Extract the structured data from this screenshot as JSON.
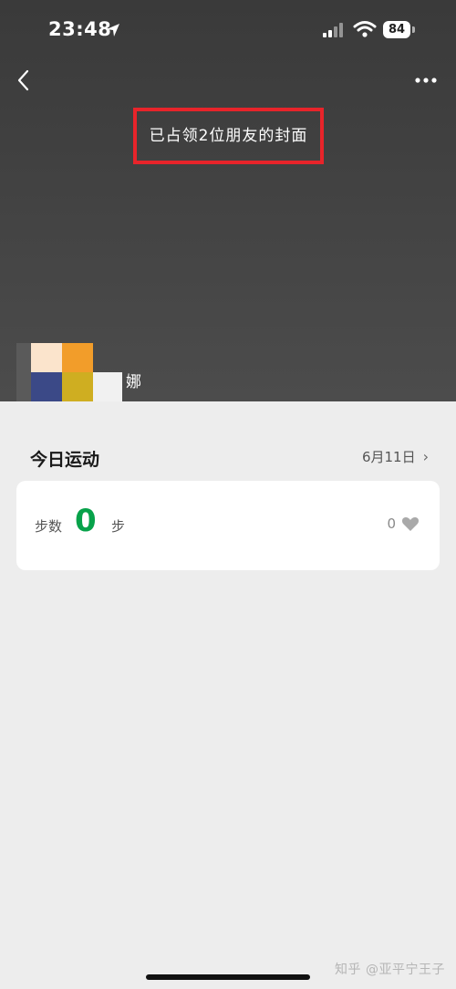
{
  "status_bar": {
    "time": "23:48",
    "battery": "84"
  },
  "cover": {
    "banner_text": "已占领2位朋友的封面",
    "user_name_fragment": "娜"
  },
  "today": {
    "title": "今日运动",
    "date": "6月11日",
    "steps_label": "步数",
    "steps_value": "0",
    "steps_unit": "步",
    "likes": "0"
  },
  "watermark": "知乎 @亚平宁王子",
  "colors": {
    "steps_accent": "#07a24a",
    "banner_border": "#e8242a"
  },
  "avatar_blocks": [
    "#fbe4cc",
    "#f29d2a",
    "#3b4987",
    "#cfae21",
    "#f1f1f1"
  ]
}
